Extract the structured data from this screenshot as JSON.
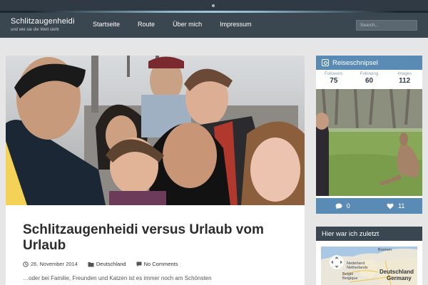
{
  "site": {
    "title": "Schlitzaugenheidi",
    "tagline": "und wie sie die Welt sieht"
  },
  "nav": {
    "items": [
      {
        "label": "Startseite"
      },
      {
        "label": "Route"
      },
      {
        "label": "Über mich"
      },
      {
        "label": "Impressum"
      }
    ]
  },
  "search": {
    "placeholder": "Search..."
  },
  "post": {
    "title": "Schlitzaugenheidi versus Urlaub vom Urlaub",
    "date": "26. November 2014",
    "category": "Deutschland",
    "comments": "No Comments",
    "excerpt": "…oder bei Familie, Freunden und Katzen ist es immer noch am Schönsten"
  },
  "instagram_widget": {
    "title": "Reiseschnipsel",
    "stats": [
      {
        "label": "Followers",
        "value": "75"
      },
      {
        "label": "Following",
        "value": "60"
      },
      {
        "label": "Images",
        "value": "112"
      }
    ],
    "comments_count": "0",
    "likes_count": "11",
    "accent_color": "#5a8bb5"
  },
  "map_widget": {
    "title": "Hier war ich zuletzt",
    "labels": {
      "bremen": "Bremen",
      "nederland": "Nederland",
      "netherlands": "Netherlands",
      "belgie": "België",
      "belgique": "Belgique",
      "deutschland": "Deutschland",
      "germany": "Germany"
    }
  },
  "icons": [
    "calendar-icon",
    "folder-icon",
    "comment-icon",
    "heart-icon",
    "instagram-icon",
    "map-pan-control-icon"
  ]
}
